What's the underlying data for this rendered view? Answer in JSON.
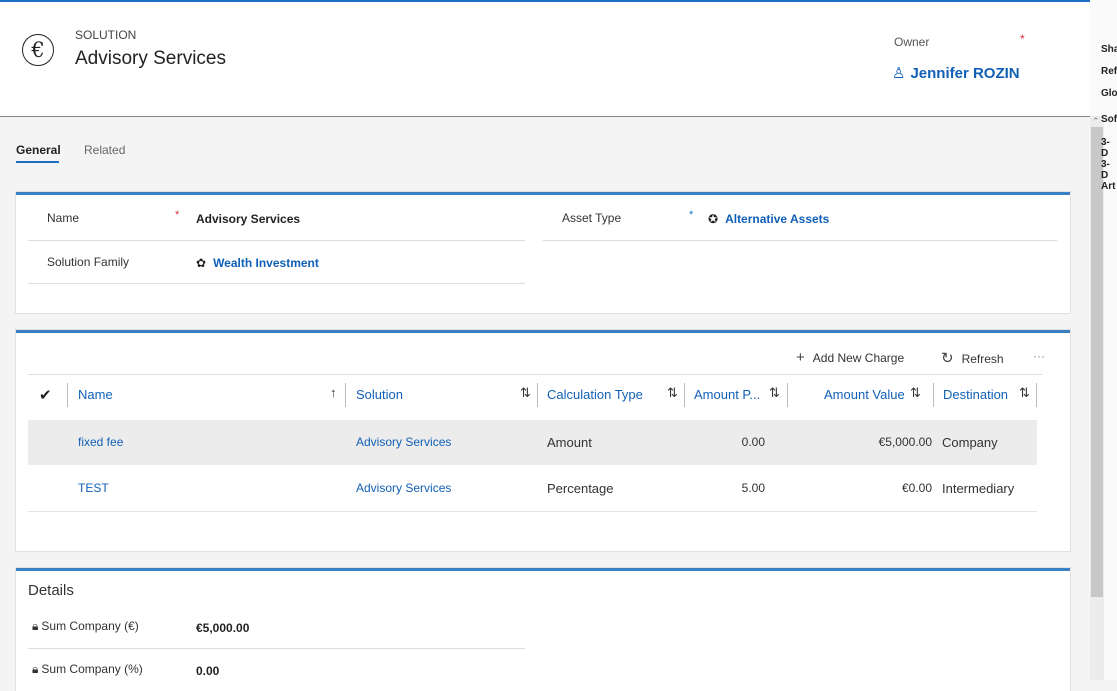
{
  "header": {
    "entity_type": "SOLUTION",
    "title": "Advisory Services",
    "entity_icon": "€",
    "owner_label": "Owner",
    "owner_required": "*",
    "owner_value": "Jennifer ROZIN"
  },
  "tabs": [
    {
      "label": "General"
    },
    {
      "label": "Related"
    }
  ],
  "general": {
    "name_label": "Name",
    "name_value": "Advisory Services",
    "solution_family_label": "Solution Family",
    "solution_family_value": "Wealth Investment",
    "asset_type_label": "Asset Type",
    "asset_type_value": "Alternative Assets",
    "required_mark": "*"
  },
  "charges": {
    "add_label": "Add New Charge",
    "refresh_label": "Refresh",
    "more_label": "···",
    "columns": [
      "Name",
      "Solution",
      "Calculation Type",
      "Amount P...",
      "Amount Value",
      "Destination"
    ],
    "rows": [
      {
        "name": "fixed fee",
        "solution": "Advisory Services",
        "calc_type": "Amount",
        "amount_p": "0.00",
        "amount_value": "€5,000.00",
        "destination": "Company"
      },
      {
        "name": "TEST",
        "solution": "Advisory Services",
        "calc_type": "Percentage",
        "amount_p": "5.00",
        "amount_value": "€0.00",
        "destination": "Intermediary"
      }
    ]
  },
  "details": {
    "title": "Details",
    "sum_company_eur_label": "Sum Company (€)",
    "sum_company_eur_value": "€5,000.00",
    "sum_company_pct_label": "Sum Company (%)",
    "sum_company_pct_value": "0.00"
  },
  "right_strip": [
    "Sha",
    "Ref",
    "Glo",
    "Sof",
    "3-D",
    "3-D",
    "Art"
  ],
  "colors": {
    "accent": "#1a6fc4",
    "link": "#1160b7",
    "required": "#d13438"
  }
}
